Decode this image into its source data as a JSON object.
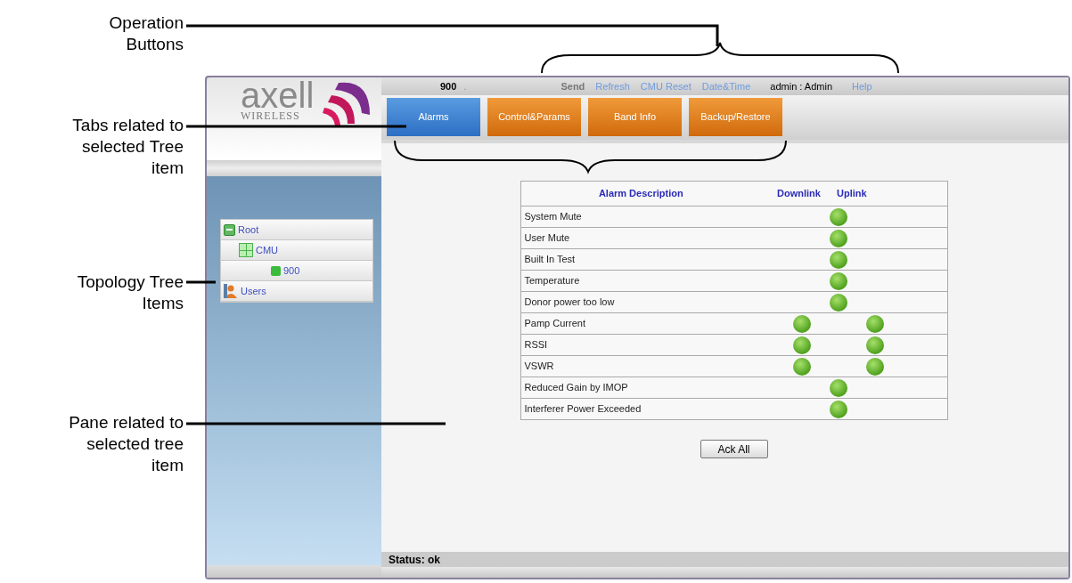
{
  "annotations": [
    {
      "text": "Operation Buttons",
      "kind": "top"
    },
    {
      "text": "Tabs related to selected Tree item",
      "kind": "tabs"
    },
    {
      "text": "Topology Tree Items",
      "kind": "tree"
    },
    {
      "text": "Pane related to selected tree item",
      "kind": "pane"
    }
  ],
  "logo": {
    "name": "axell",
    "tagline": "WIRELESS"
  },
  "top_bar": {
    "device": "900",
    "dot": ".",
    "items": [
      {
        "label": "Send",
        "kind": "plain"
      },
      {
        "label": "Refresh",
        "kind": "link"
      },
      {
        "label": "CMU Reset",
        "kind": "link"
      },
      {
        "label": "Date&Time",
        "kind": "link"
      },
      {
        "label": "admin : Admin",
        "kind": "user"
      },
      {
        "label": "Help",
        "kind": "link"
      }
    ]
  },
  "tabs": [
    {
      "label": "Alarms",
      "selected": true
    },
    {
      "label": "Control&Params",
      "selected": false
    },
    {
      "label": "Band Info",
      "selected": false
    },
    {
      "label": "Backup/Restore",
      "selected": false
    }
  ],
  "tree": [
    {
      "label": "Root",
      "kind": "root",
      "children": [
        {
          "label": "CMU",
          "kind": "group",
          "children": [
            {
              "label": "900",
              "kind": "device"
            }
          ]
        }
      ]
    },
    {
      "label": "Users",
      "kind": "users"
    }
  ],
  "table": {
    "columns": [
      "Alarm Description",
      "Downlink",
      "Uplink"
    ],
    "rows": [
      {
        "description": "System Mute",
        "kind": "combined"
      },
      {
        "description": "User Mute",
        "kind": "combined"
      },
      {
        "description": "Built In Test",
        "kind": "combined"
      },
      {
        "description": "Temperature",
        "kind": "combined"
      },
      {
        "description": "Donor power too low",
        "kind": "combined"
      },
      {
        "description": "Pamp Current",
        "kind": "split"
      },
      {
        "description": "RSSI",
        "kind": "split"
      },
      {
        "description": "VSWR",
        "kind": "split"
      },
      {
        "description": "Reduced Gain by IMOP",
        "kind": "combined"
      },
      {
        "description": "Interferer Power Exceeded",
        "kind": "combined"
      }
    ]
  },
  "ack_button": "Ack All",
  "status_bar": "Status: ok"
}
